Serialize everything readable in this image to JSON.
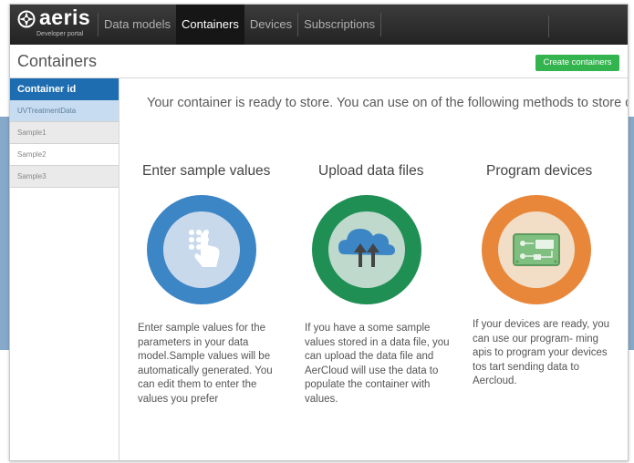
{
  "app": {
    "logo_text": "aeris",
    "logo_subtitle": "Developer portal"
  },
  "nav": {
    "items": [
      {
        "label": "Data models",
        "active": false
      },
      {
        "label": "Containers",
        "active": true
      },
      {
        "label": "Devices",
        "active": false
      },
      {
        "label": "Subscriptions",
        "active": false
      }
    ]
  },
  "page": {
    "title": "Containers",
    "create_button": "Create containers"
  },
  "sidebar": {
    "header": "Container id",
    "items": [
      {
        "label": "UVTreatmentData",
        "selected": true
      },
      {
        "label": "Sample1",
        "selected": false
      },
      {
        "label": "Sample2",
        "selected": false
      },
      {
        "label": "Sample3",
        "selected": false
      }
    ]
  },
  "main": {
    "message": "Your container is ready to store. You can use on of the following methods to store data:",
    "columns": [
      {
        "title": "Enter sample values",
        "icon": "keypad-touch-icon",
        "text": "Enter sample values for the parameters in your data model.Sample values will be automatically generated. You can edit them to enter the values you prefer"
      },
      {
        "title": "Upload data files",
        "icon": "cloud-upload-icon",
        "text": "If you have a some sample values stored in a data file, you can upload the data file and AerCloud will use the data to populate the container with values."
      },
      {
        "title": "Program devices",
        "icon": "circuit-board-icon",
        "text": "If your devices are ready, you can use our program- ming apis to program your devices tos tart sending data to Aercloud."
      }
    ]
  },
  "colors": {
    "nav_bg": "#2b2b2b",
    "sidebar_header": "#1f6db1",
    "sidebar_selected": "#c7dcf0",
    "create_button": "#34b44f",
    "enter_circle": "#3d86c6",
    "upload_circle": "#1f8f53",
    "program_circle": "#e8873a"
  }
}
